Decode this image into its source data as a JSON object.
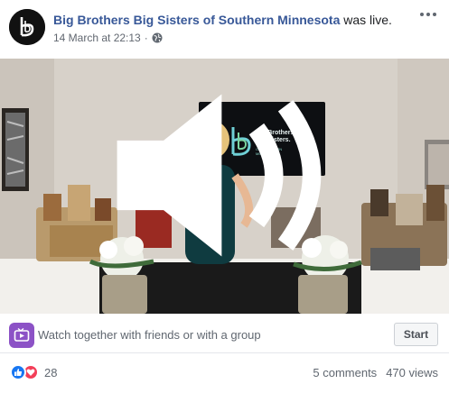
{
  "post": {
    "page_name": "Big Brothers Big Sisters of Southern Minnesota",
    "action_text": " was live.",
    "timestamp": "14 March at 22:13",
    "privacy_icon": "globe-icon"
  },
  "video": {
    "screen_title_line1": "Big Brothers",
    "screen_title_line2": "Big Sisters.",
    "screen_subtitle_line1": "OF SOUTHERN",
    "screen_subtitle_line2": "MINNESOTA"
  },
  "watch_party": {
    "text": "Watch together with friends or with a group",
    "button_label": "Start"
  },
  "engagement": {
    "reaction_count": "28",
    "comments": "5 comments",
    "views": "470 views"
  },
  "colors": {
    "link_blue": "#385898",
    "like_blue": "#1877f2",
    "love_red": "#f33e58",
    "watch_purple": "#8c52c6"
  }
}
